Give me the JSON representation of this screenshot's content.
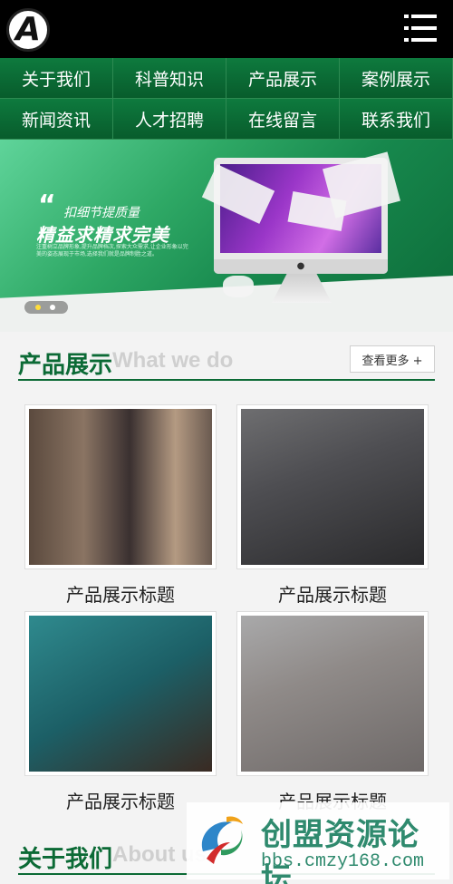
{
  "header": {
    "logo_letter": "A",
    "menu_icon": "menu-icon"
  },
  "nav": {
    "items": [
      "关于我们",
      "科普知识",
      "产品展示",
      "案例展示",
      "新闻资讯",
      "人才招聘",
      "在线留言",
      "联系我们"
    ]
  },
  "banner": {
    "slogan_top": "扣细节提质量",
    "slogan_main": "精益求精求完美",
    "slogan_sub": "注重树立品牌形象,提升品牌档次,探索大众需求,让企业形象以完美的姿态展现于市场,选择我们就是品牌制胜之道。",
    "slide_count": 2,
    "active_slide": 1
  },
  "products": {
    "title": "产品展示",
    "subtitle_en": "What we do",
    "more_label": "查看更多 +",
    "items": [
      {
        "caption": "产品展示标题"
      },
      {
        "caption": "产品展示标题"
      },
      {
        "caption": "产品展示标题"
      },
      {
        "caption": "产品展示标题"
      }
    ]
  },
  "about": {
    "title": "关于我们",
    "subtitle_en": "About us"
  },
  "watermark": {
    "title": "创盟资源论坛",
    "url": "bbs.cmzy168.com"
  },
  "colors": {
    "brand_green": "#0b6a35",
    "nav_border": "#2d8a52",
    "header_bg": "#000000"
  }
}
